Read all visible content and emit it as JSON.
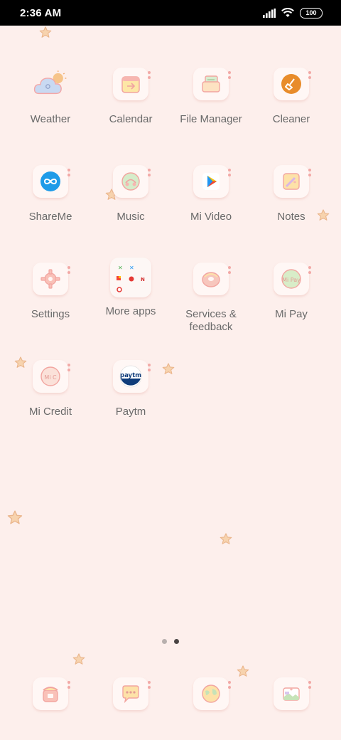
{
  "status_bar": {
    "time": "2:36 AM",
    "battery": "100"
  },
  "apps": [
    {
      "label": "Weather",
      "icon": "weather-cloud-icon"
    },
    {
      "label": "Calendar",
      "icon": "calendar-icon"
    },
    {
      "label": "File Manager",
      "icon": "file-manager-icon"
    },
    {
      "label": "Cleaner",
      "icon": "cleaner-broom-icon"
    },
    {
      "label": "ShareMe",
      "icon": "shareme-icon"
    },
    {
      "label": "Music",
      "icon": "music-icon"
    },
    {
      "label": "Mi Video",
      "icon": "play-icon"
    },
    {
      "label": "Notes",
      "icon": "notes-icon"
    },
    {
      "label": "Settings",
      "icon": "gear-icon"
    },
    {
      "label": "More apps",
      "icon": "app-folder-icon"
    },
    {
      "label": "Services & feedback",
      "icon": "services-donut-icon"
    },
    {
      "label": "Mi Pay",
      "icon": "mi-pay-icon"
    },
    {
      "label": "Mi Credit",
      "icon": "mi-credit-icon"
    },
    {
      "label": "Paytm",
      "icon": "paytm-icon"
    }
  ],
  "mi_pay_icon_text": "Mi Pay",
  "mi_credit_icon_text": "Mi C",
  "paytm_icon_text": "paytm",
  "dock": [
    {
      "icon": "phone-icon"
    },
    {
      "icon": "messages-icon"
    },
    {
      "icon": "browser-globe-icon"
    },
    {
      "icon": "gallery-icon"
    }
  ],
  "page_indicator": {
    "pages": 2,
    "current": 2
  },
  "colors": {
    "background": "#fdefec",
    "label": "#6a6a6a",
    "accent_orange": "#e88c2a",
    "shareme_blue": "#1e9be8"
  }
}
